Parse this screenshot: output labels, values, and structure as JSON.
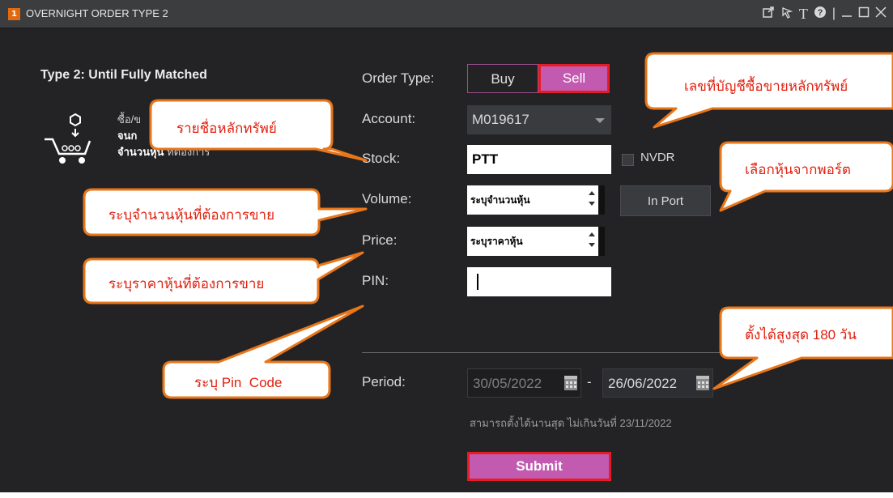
{
  "window": {
    "badge": "1",
    "title": "OVERNIGHT ORDER TYPE 2",
    "controls": [
      "popout-icon",
      "pointer-icon",
      "text-icon",
      "help-icon",
      "minimize-icon",
      "maximize-icon",
      "close-icon"
    ]
  },
  "sidepanel": {
    "heading": "Type 2: Until Fully Matched",
    "line1": "ซื้อ/ข",
    "line2": "จนก",
    "line3_bold": "จำนวนหุ้น",
    "line3_rest": " ที่ต้องการ",
    "icon": "shopping-cart-icon"
  },
  "form": {
    "order_type_label": "Order Type:",
    "buy_label": "Buy",
    "sell_label": "Sell",
    "account_label": "Account:",
    "account_value": "M019617",
    "stock_label": "Stock:",
    "stock_value": "PTT",
    "nvdr_label": "NVDR",
    "volume_label": "Volume:",
    "volume_placeholder": "ระบุจำนวนหุ้น",
    "inport_label": "In Port",
    "price_label": "Price:",
    "price_placeholder": "ระบุราคาหุ้น",
    "pin_label": "PIN:",
    "period_label": "Period:",
    "date_from": "30/05/2022",
    "date_sep": "-",
    "date_to": "26/06/2022",
    "note": "สามารถตั้งได้นานสุด ไม่เกินวันที่ 23/11/2022",
    "submit_label": "Submit"
  },
  "callouts": {
    "account_no": "เลขที่บัญชีซื้อขายหลักทรัพย์",
    "stock_list": "รายชื่อหลักทรัพย์",
    "from_port": "เลือกหุ้นจากพอร์ต",
    "volume": "ระบุจำนวนหุ้นที่ต้องการขาย",
    "price": "ระบุราคาหุ้นที่ต้องการขาย",
    "pin": "ระบุ Pin  Code",
    "max_days": "ตั้งได้สูงสุด 180 วัน"
  },
  "colors": {
    "window_bg": "#232325",
    "accent_pink": "#c25ab0",
    "highlight_red": "#e51c23",
    "callout_orange": "#e8761a",
    "callout_text": "#e0200f"
  }
}
